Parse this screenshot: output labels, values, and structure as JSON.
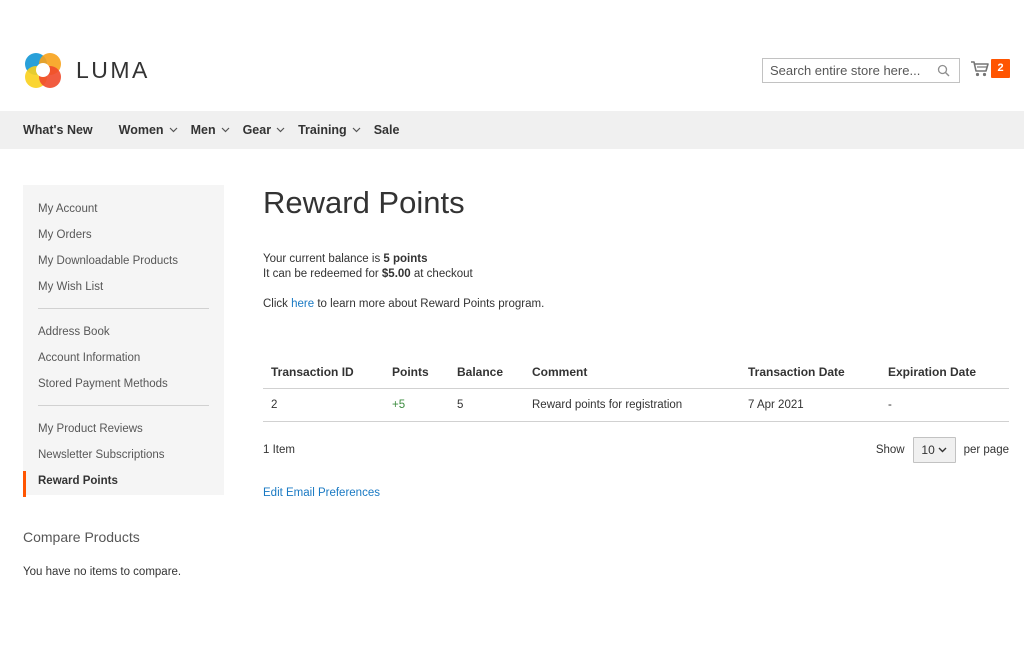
{
  "header": {
    "logo_text": "LUMA",
    "search": {
      "placeholder": "Search entire store here..."
    },
    "cart": {
      "count": "2"
    }
  },
  "nav": {
    "items": [
      {
        "label": "What's New",
        "has_dropdown": false
      },
      {
        "label": "Women",
        "has_dropdown": true
      },
      {
        "label": "Men",
        "has_dropdown": true
      },
      {
        "label": "Gear",
        "has_dropdown": true
      },
      {
        "label": "Training",
        "has_dropdown": true
      },
      {
        "label": "Sale",
        "has_dropdown": false
      }
    ]
  },
  "sidebar": {
    "items": [
      "My Account",
      "My Orders",
      "My Downloadable Products",
      "My Wish List",
      "Address Book",
      "Account Information",
      "Stored Payment Methods",
      "My Product Reviews",
      "Newsletter Subscriptions",
      "Reward Points"
    ],
    "current": "Reward Points"
  },
  "compare": {
    "title": "Compare Products",
    "empty_text": "You have no items to compare."
  },
  "main": {
    "title": "Reward Points",
    "balance": {
      "line1_prefix": "Your current balance is ",
      "points": "5 points",
      "line2_prefix": "It can be redeemed for ",
      "amount": "$5.00",
      "line2_suffix": " at checkout"
    },
    "learn": {
      "prefix": "Click ",
      "link": "here",
      "suffix": " to learn more about Reward Points program."
    },
    "table": {
      "headers": [
        "Transaction ID",
        "Points",
        "Balance",
        "Comment",
        "Transaction Date",
        "Expiration Date"
      ],
      "rows": [
        [
          "2",
          "+5",
          "5",
          "Reward points for registration",
          "7 Apr 2021",
          "-"
        ]
      ]
    },
    "toolbar": {
      "count": "1 Item",
      "show_label": "Show",
      "limit": "10",
      "per_page_label": "per page"
    },
    "edit_prefs": "Edit Email Preferences"
  },
  "colors": {
    "accent": "#ff5501",
    "link": "#1979c3",
    "positive": "#3d8c40",
    "nav_bg": "#f0f0f0",
    "sidebar_bg": "#f5f5f5"
  }
}
